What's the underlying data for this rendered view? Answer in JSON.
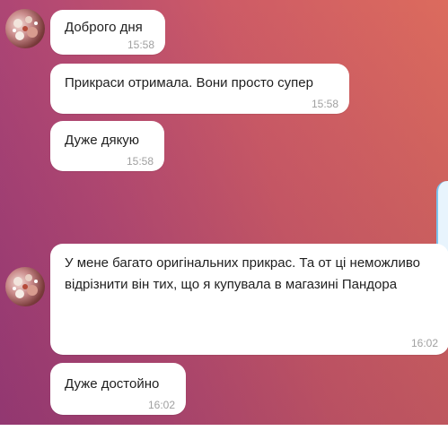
{
  "messages": [
    {
      "text": "Доброго дня",
      "time": "15:58"
    },
    {
      "text": "Прикраси отримала. Вони просто супер",
      "time": "15:58"
    },
    {
      "text": "Дуже дякую",
      "time": "15:58"
    },
    {
      "text": "У мене багато оригінальних прикрас. Та от ці неможливо відрізнити він тих, що я купувала в магазині Пандора",
      "time": "16:02"
    },
    {
      "text": "Дуже достойно",
      "time": "16:02"
    }
  ],
  "colors": {
    "bubble": "#ffffff",
    "timestamp": "#a0a0a0",
    "gradient_start": "#9e3d78",
    "gradient_end": "#dc6b5d"
  }
}
